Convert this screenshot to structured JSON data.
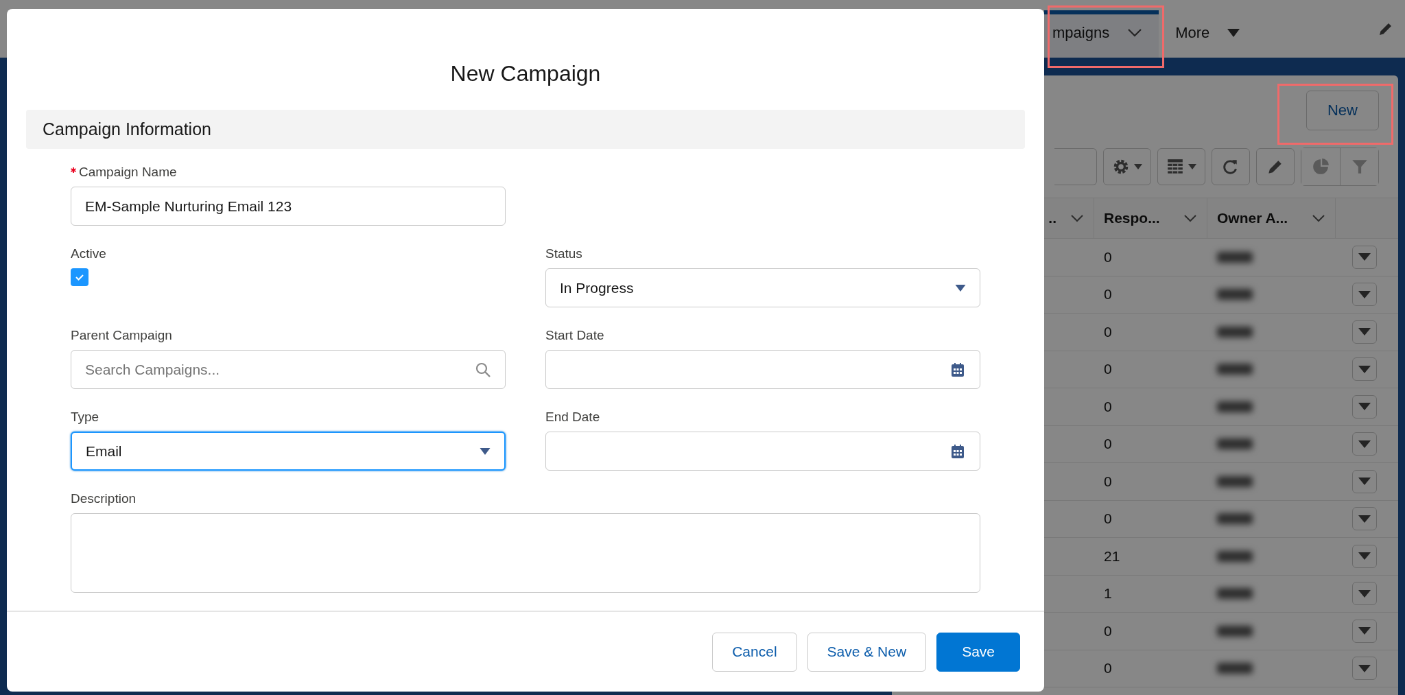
{
  "background": {
    "nav_tabs": [
      {
        "label": "mpaigns",
        "selected": true,
        "kind": "chevron"
      },
      {
        "label": "More",
        "selected": false,
        "kind": "triangle"
      }
    ],
    "new_button": "New",
    "table": {
      "columns": [
        "..",
        "Respo...",
        "Owner A..."
      ],
      "rows": [
        {
          "responses": "0"
        },
        {
          "responses": "0"
        },
        {
          "responses": "0"
        },
        {
          "responses": "0"
        },
        {
          "responses": "0"
        },
        {
          "responses": "0"
        },
        {
          "responses": "0"
        },
        {
          "responses": "0"
        },
        {
          "responses": "21"
        },
        {
          "responses": "1"
        },
        {
          "responses": "0"
        },
        {
          "responses": "0"
        }
      ]
    }
  },
  "modal": {
    "title": "New Campaign",
    "section": "Campaign Information",
    "rows": [
      [
        {
          "kind": "text",
          "label": "Campaign Name",
          "required": true,
          "value": "EM-Sample Nurturing Email 123",
          "focused": false
        }
      ],
      [
        {
          "kind": "checkbox",
          "label": "Active",
          "required": false,
          "checked": true
        },
        {
          "kind": "select",
          "label": "Status",
          "required": false,
          "value": "In Progress",
          "focused": false
        }
      ],
      [
        {
          "kind": "lookup",
          "label": "Parent Campaign",
          "required": false,
          "placeholder": "Search Campaigns...",
          "focused": false
        },
        {
          "kind": "date",
          "label": "Start Date",
          "required": false,
          "focused": false
        }
      ],
      [
        {
          "kind": "select",
          "label": "Type",
          "required": false,
          "value": "Email",
          "focused": true
        },
        {
          "kind": "date",
          "label": "End Date",
          "required": false,
          "focused": false
        }
      ],
      [
        {
          "kind": "textarea",
          "label": "Description",
          "required": false,
          "focused": false
        }
      ]
    ],
    "buttons": [
      {
        "label": "Cancel",
        "kind": "neutral"
      },
      {
        "label": "Save & New",
        "kind": "neutral"
      },
      {
        "label": "Save",
        "kind": "brand"
      }
    ]
  }
}
